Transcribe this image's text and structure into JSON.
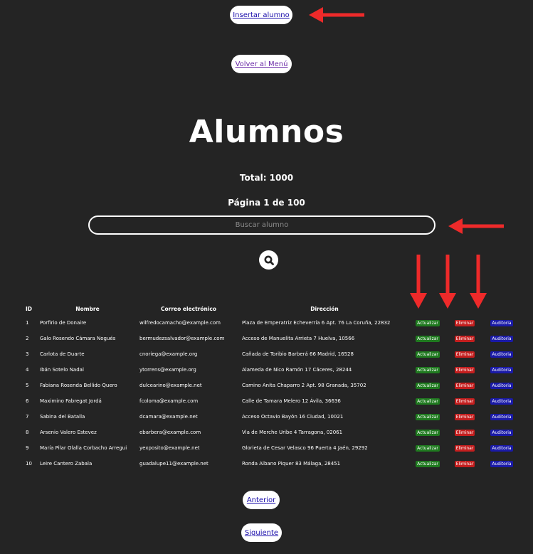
{
  "buttons": {
    "insert": "Insertar alumno",
    "menu": "Volver al Menú",
    "prev": "Anterior",
    "next": "Siguiente"
  },
  "header": {
    "title": "Alumnos",
    "total": "Total: 1000",
    "pagina": "Página 1 de 100"
  },
  "search": {
    "placeholder": "Buscar alumno"
  },
  "table": {
    "columns": [
      "ID",
      "Nombre",
      "Correo electrónico",
      "Dirección"
    ],
    "action_labels": {
      "update": "Actualizar",
      "delete": "Eliminar",
      "audit": "Auditoria"
    },
    "rows": [
      {
        "id": "1",
        "nombre": "Porfirio de Donaire",
        "correo": "wilfredocamacho@example.com",
        "direccion": "Plaza de Emperatriz Echeverría 6 Apt. 76 La Coruña, 22832"
      },
      {
        "id": "2",
        "nombre": "Galo Rosendo Cámara Nogués",
        "correo": "bermudezsalvador@example.com",
        "direccion": "Acceso de Manuelita Arrieta 7 Huelva, 10566"
      },
      {
        "id": "3",
        "nombre": "Carlota de Duarte",
        "correo": "cnoriega@example.org",
        "direccion": "Cañada de Toribio Barberá 66 Madrid, 16528"
      },
      {
        "id": "4",
        "nombre": "Ibán Sotelo Nadal",
        "correo": "ytorrens@example.org",
        "direccion": "Alameda de Nico Ramón 17 Cáceres, 28244"
      },
      {
        "id": "5",
        "nombre": "Fabiana Rosenda Bellido Quero",
        "correo": "dulcearino@example.net",
        "direccion": "Camino Anita Chaparro 2 Apt. 98 Granada, 35702"
      },
      {
        "id": "6",
        "nombre": "Maximino Fabregat Jordá",
        "correo": "fcoloma@example.com",
        "direccion": "Calle de Tamara Melero 12 Ávila, 36636"
      },
      {
        "id": "7",
        "nombre": "Sabina del Batalla",
        "correo": "dcamara@example.net",
        "direccion": "Acceso Octavio Bayón 16 Ciudad, 10021"
      },
      {
        "id": "8",
        "nombre": "Arsenio Valero Estevez",
        "correo": "ebarbera@example.com",
        "direccion": "Via de Merche Uribe 4 Tarragona, 02061"
      },
      {
        "id": "9",
        "nombre": "María Pilar Olalla Corbacho Arregui",
        "correo": "yexposito@example.net",
        "direccion": "Glorieta de Cesar Velasco 96 Puerta 4 Jaén, 29292"
      },
      {
        "id": "10",
        "nombre": "Leire Cantero Zabala",
        "correo": "guadalupe11@example.net",
        "direccion": "Ronda Albano Piquer 83 Málaga, 28451"
      }
    ]
  },
  "colors": {
    "background": "#242424",
    "arrow": "#ee2a2a",
    "update": "#1f7a1f",
    "delete": "#c41e1e",
    "audit": "#1a1aa8"
  }
}
